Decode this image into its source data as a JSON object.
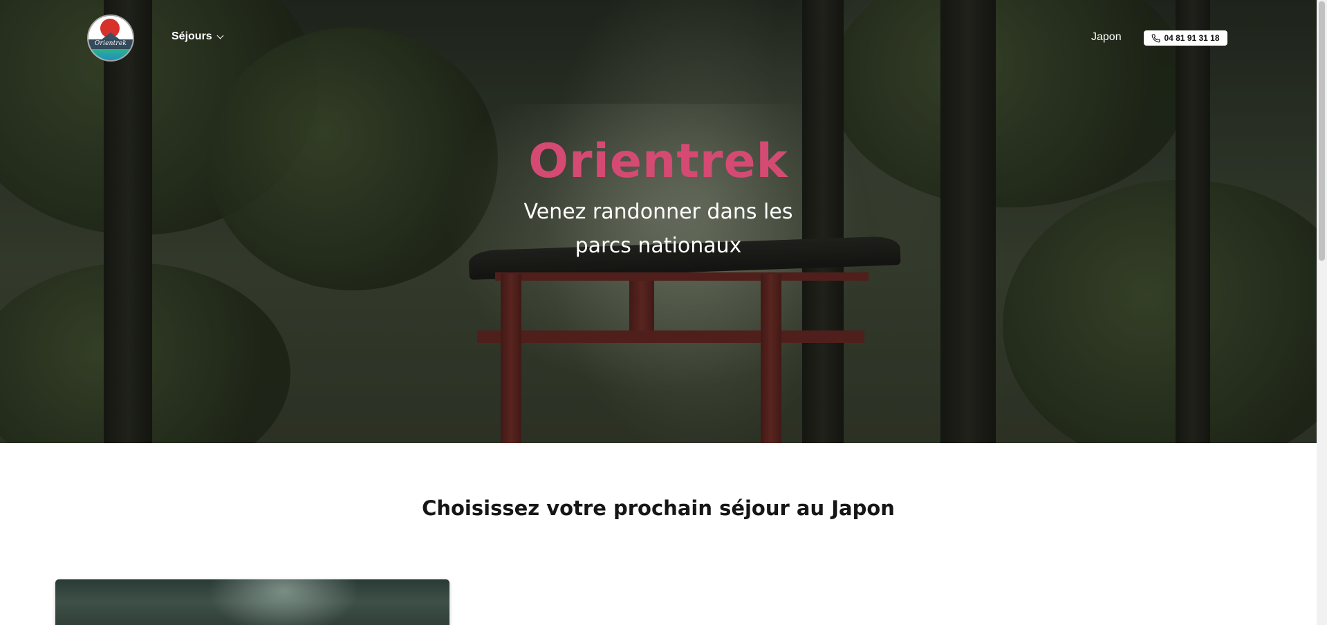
{
  "brand": {
    "logo_text": "Orientrek"
  },
  "nav": {
    "sejours_label": "Séjours",
    "japon_label": "Japon",
    "phone": "04 81 91 31 18"
  },
  "hero": {
    "title": "Orientrek",
    "subtitle": "Venez randonner dans les parcs nationaux"
  },
  "main": {
    "section_title": "Choisissez votre prochain séjour au Japon"
  },
  "colors": {
    "hero_title": "#d54a73",
    "phone_button_bg": "#ffffff",
    "logo_sun": "#d7312c"
  },
  "icons": {
    "dropdown": "chevron-down-icon",
    "phone": "phone-icon"
  }
}
